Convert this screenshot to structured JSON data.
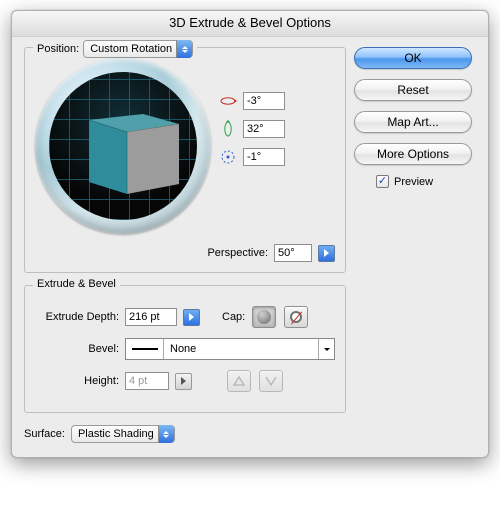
{
  "title": "3D Extrude & Bevel Options",
  "position": {
    "legend": "Position:",
    "preset": "Custom Rotation",
    "rot_x": "-3°",
    "rot_y": "32°",
    "rot_z": "-1°",
    "perspective_label": "Perspective:",
    "perspective": "50°"
  },
  "extrude": {
    "legend": "Extrude & Bevel",
    "depth_label": "Extrude Depth:",
    "depth": "216 pt",
    "cap_label": "Cap:",
    "bevel_label": "Bevel:",
    "bevel_value": "None",
    "height_label": "Height:",
    "height": "4 pt"
  },
  "surface": {
    "label": "Surface:",
    "value": "Plastic Shading"
  },
  "buttons": {
    "ok": "OK",
    "reset": "Reset",
    "map_art": "Map Art...",
    "more_options": "More Options",
    "preview": "Preview"
  }
}
